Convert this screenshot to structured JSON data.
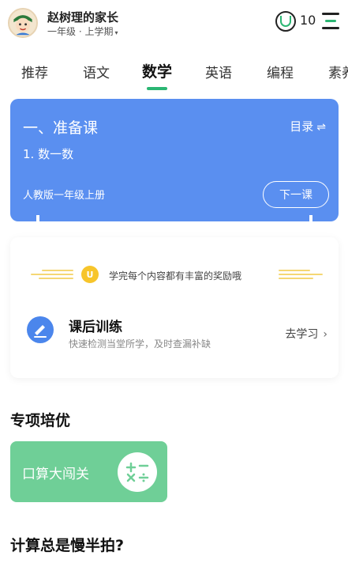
{
  "header": {
    "user_name": "赵树理的家长",
    "grade_label": "一年级 · 上学期",
    "grade_caret": "▾",
    "coin_count": "10"
  },
  "tabs": [
    {
      "label": "推荐",
      "active": false
    },
    {
      "label": "语文",
      "active": false
    },
    {
      "label": "数学",
      "active": true
    },
    {
      "label": "英语",
      "active": false
    },
    {
      "label": "编程",
      "active": false
    },
    {
      "label": "素养",
      "active": false
    }
  ],
  "lesson": {
    "title": "一、准备课",
    "catalog_label": "目录",
    "catalog_icon": "⇌",
    "subtitle": "1. 数一数",
    "edition": "人教版一年级上册",
    "next_button": "下一课",
    "color": "#5a8ff0"
  },
  "reward": {
    "coin_glyph": "U",
    "text": "学完每个内容都有丰富的奖励哦"
  },
  "training": {
    "title": "课后训练",
    "description": "快速检测当堂所学，及时查漏补缺",
    "action": "去学习",
    "action_chevron": "›"
  },
  "special": {
    "section_title": "专项培优",
    "card_label": "口算大闯关",
    "card_color": "#6fcf97"
  },
  "next_section": {
    "title": "计算总是慢半拍?"
  },
  "colors": {
    "accent": "#2bb673",
    "coin_yellow": "#f7c52b"
  }
}
